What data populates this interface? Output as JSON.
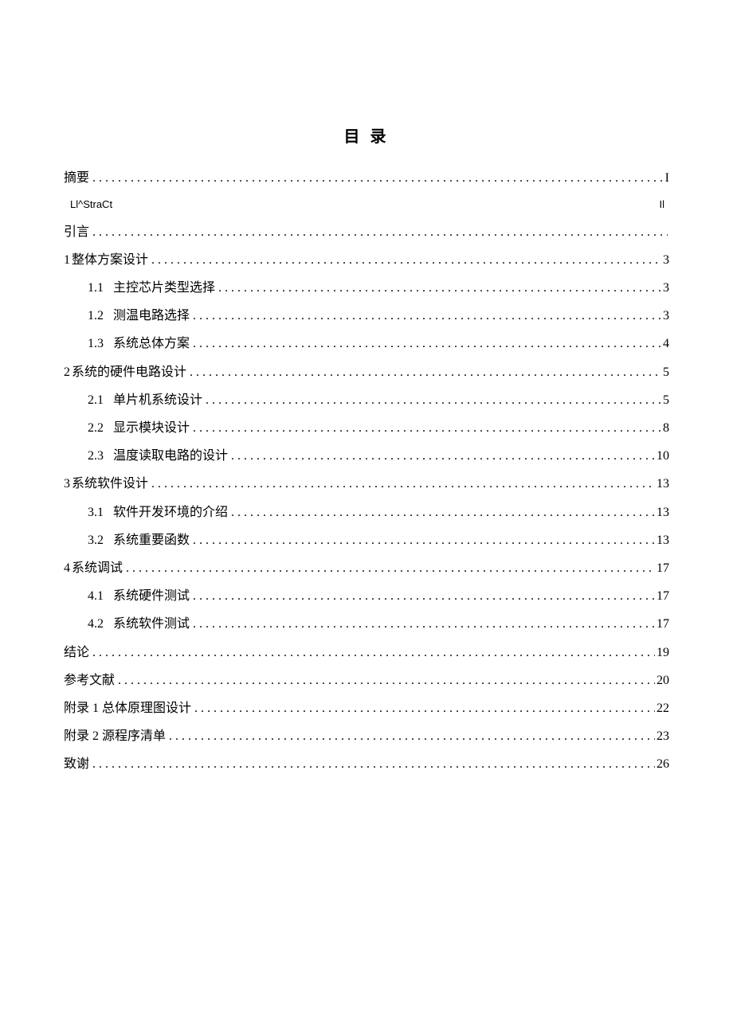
{
  "title": "目 录",
  "abstract_en": {
    "label": "Ll^StraCt",
    "page": "Il"
  },
  "entries": [
    {
      "level": 0,
      "num": "",
      "label": "摘要",
      "page": "I",
      "dots": true
    },
    {
      "level": -1
    },
    {
      "level": 0,
      "num": "",
      "label": "引言",
      "page": "",
      "dots": true
    },
    {
      "level": 0,
      "num": "1",
      "label": "整体方案设计",
      "page": "3",
      "dots": true,
      "cnnum": true
    },
    {
      "level": 1,
      "num": "1.1",
      "label": "主控芯片类型选择",
      "page": "3",
      "dots": true
    },
    {
      "level": 1,
      "num": "1.2",
      "label": "测温电路选择",
      "page": "3",
      "dots": true
    },
    {
      "level": 1,
      "num": "1.3",
      "label": "系统总体方案",
      "page": "4",
      "dots": true
    },
    {
      "level": 0,
      "num": "2",
      "label": "系统的硬件电路设计",
      "page": "5",
      "dots": true,
      "cnnum": true
    },
    {
      "level": 1,
      "num": "2.1",
      "label": "单片机系统设计",
      "page": "5",
      "dots": true
    },
    {
      "level": 1,
      "num": "2.2",
      "label": "显示模块设计",
      "page": "8",
      "dots": true
    },
    {
      "level": 1,
      "num": "2.3",
      "label": "温度读取电路的设计",
      "page": "10",
      "dots": true
    },
    {
      "level": 0,
      "num": "3",
      "label": "系统软件设计",
      "page": "13",
      "dots": true,
      "cnnum": true
    },
    {
      "level": 1,
      "num": "3.1",
      "label": "软件开发环境的介绍",
      "page": "13",
      "dots": true
    },
    {
      "level": 1,
      "num": "3.2",
      "label": "系统重要函数",
      "page": "13",
      "dots": true
    },
    {
      "level": 0,
      "num": "4",
      "label": "系统调试",
      "page": "17",
      "dots": true,
      "cnnum": true
    },
    {
      "level": 1,
      "num": "4.1",
      "label": "系统硬件测试",
      "page": "17",
      "dots": true
    },
    {
      "level": 1,
      "num": "4.2",
      "label": "系统软件测试",
      "page": "17",
      "dots": true
    },
    {
      "level": 0,
      "num": "",
      "label": "结论",
      "page": "19",
      "dots": true
    },
    {
      "level": 0,
      "num": "",
      "label": "参考文献",
      "page": "20",
      "dots": true
    },
    {
      "level": 0,
      "num": "",
      "label": "附录 1 总体原理图设计",
      "page": "22",
      "dots": true
    },
    {
      "level": 0,
      "num": "",
      "label": "附录 2 源程序清单",
      "page": "23",
      "dots": true
    },
    {
      "level": 0,
      "num": "",
      "label": "致谢",
      "page": "26",
      "dots": true
    }
  ]
}
